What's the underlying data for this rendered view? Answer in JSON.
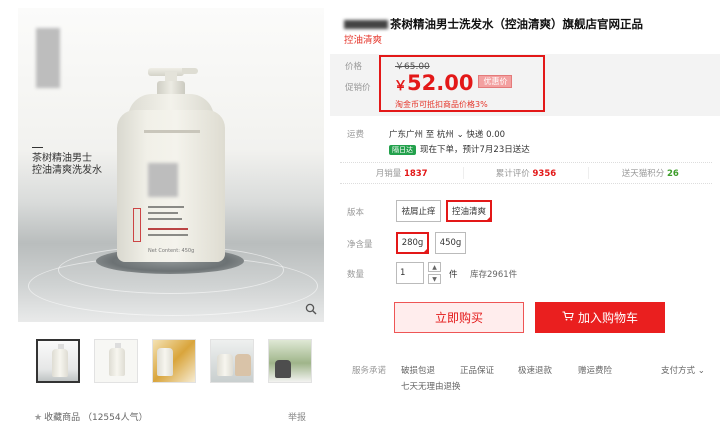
{
  "product": {
    "title": "茶树精油男士洗发水（控油清爽）旗舰店官网正品",
    "subtitle": "控油清爽",
    "image_text_line1": "茶树精油男士",
    "image_text_line2": "控油清爽洗发水",
    "bottle_net_content": "Net Content: 450g"
  },
  "price": {
    "label_price": "价格",
    "label_promo": "促销价",
    "original": "￥65.00",
    "currency": "￥",
    "current": "52.00",
    "promo_tag": "优惠价",
    "coin_note": "淘金币可抵扣商品价格3%"
  },
  "shipping": {
    "label": "运费",
    "route": "广东广州 至 杭州 ⌄ 快递 0.00",
    "badge": "隔日达",
    "eta": "现在下单，预计7月23日送达"
  },
  "stats": [
    {
      "label": "月销量",
      "value": "1837",
      "color": "red"
    },
    {
      "label": "累计评价",
      "value": "9356",
      "color": "red"
    },
    {
      "label": "送天猫积分",
      "value": "26",
      "color": "green"
    }
  ],
  "options": {
    "version_label": "版本",
    "versions": [
      "祛屑止痒",
      "控油清爽"
    ],
    "version_selected": "控油清爽",
    "weight_label": "净含量",
    "weights": [
      "280g",
      "450g"
    ],
    "weight_selected": "280g",
    "qty_label": "数量",
    "qty_value": "1",
    "qty_unit": "件",
    "stock": "库存2961件"
  },
  "actions": {
    "buy_now": "立即购买",
    "add_cart": "加入购物车"
  },
  "services": {
    "label": "服务承诺",
    "items": [
      "破损包退",
      "正品保证",
      "极速退款",
      "赠运费险"
    ],
    "line2": "七天无理由退换",
    "payment": "支付方式 ⌄"
  },
  "footer": {
    "favorite": "收藏商品",
    "favorite_count": "（12554人气）",
    "report": "举报"
  },
  "colors": {
    "accent_red": "#e31818",
    "green": "#23a14c"
  }
}
